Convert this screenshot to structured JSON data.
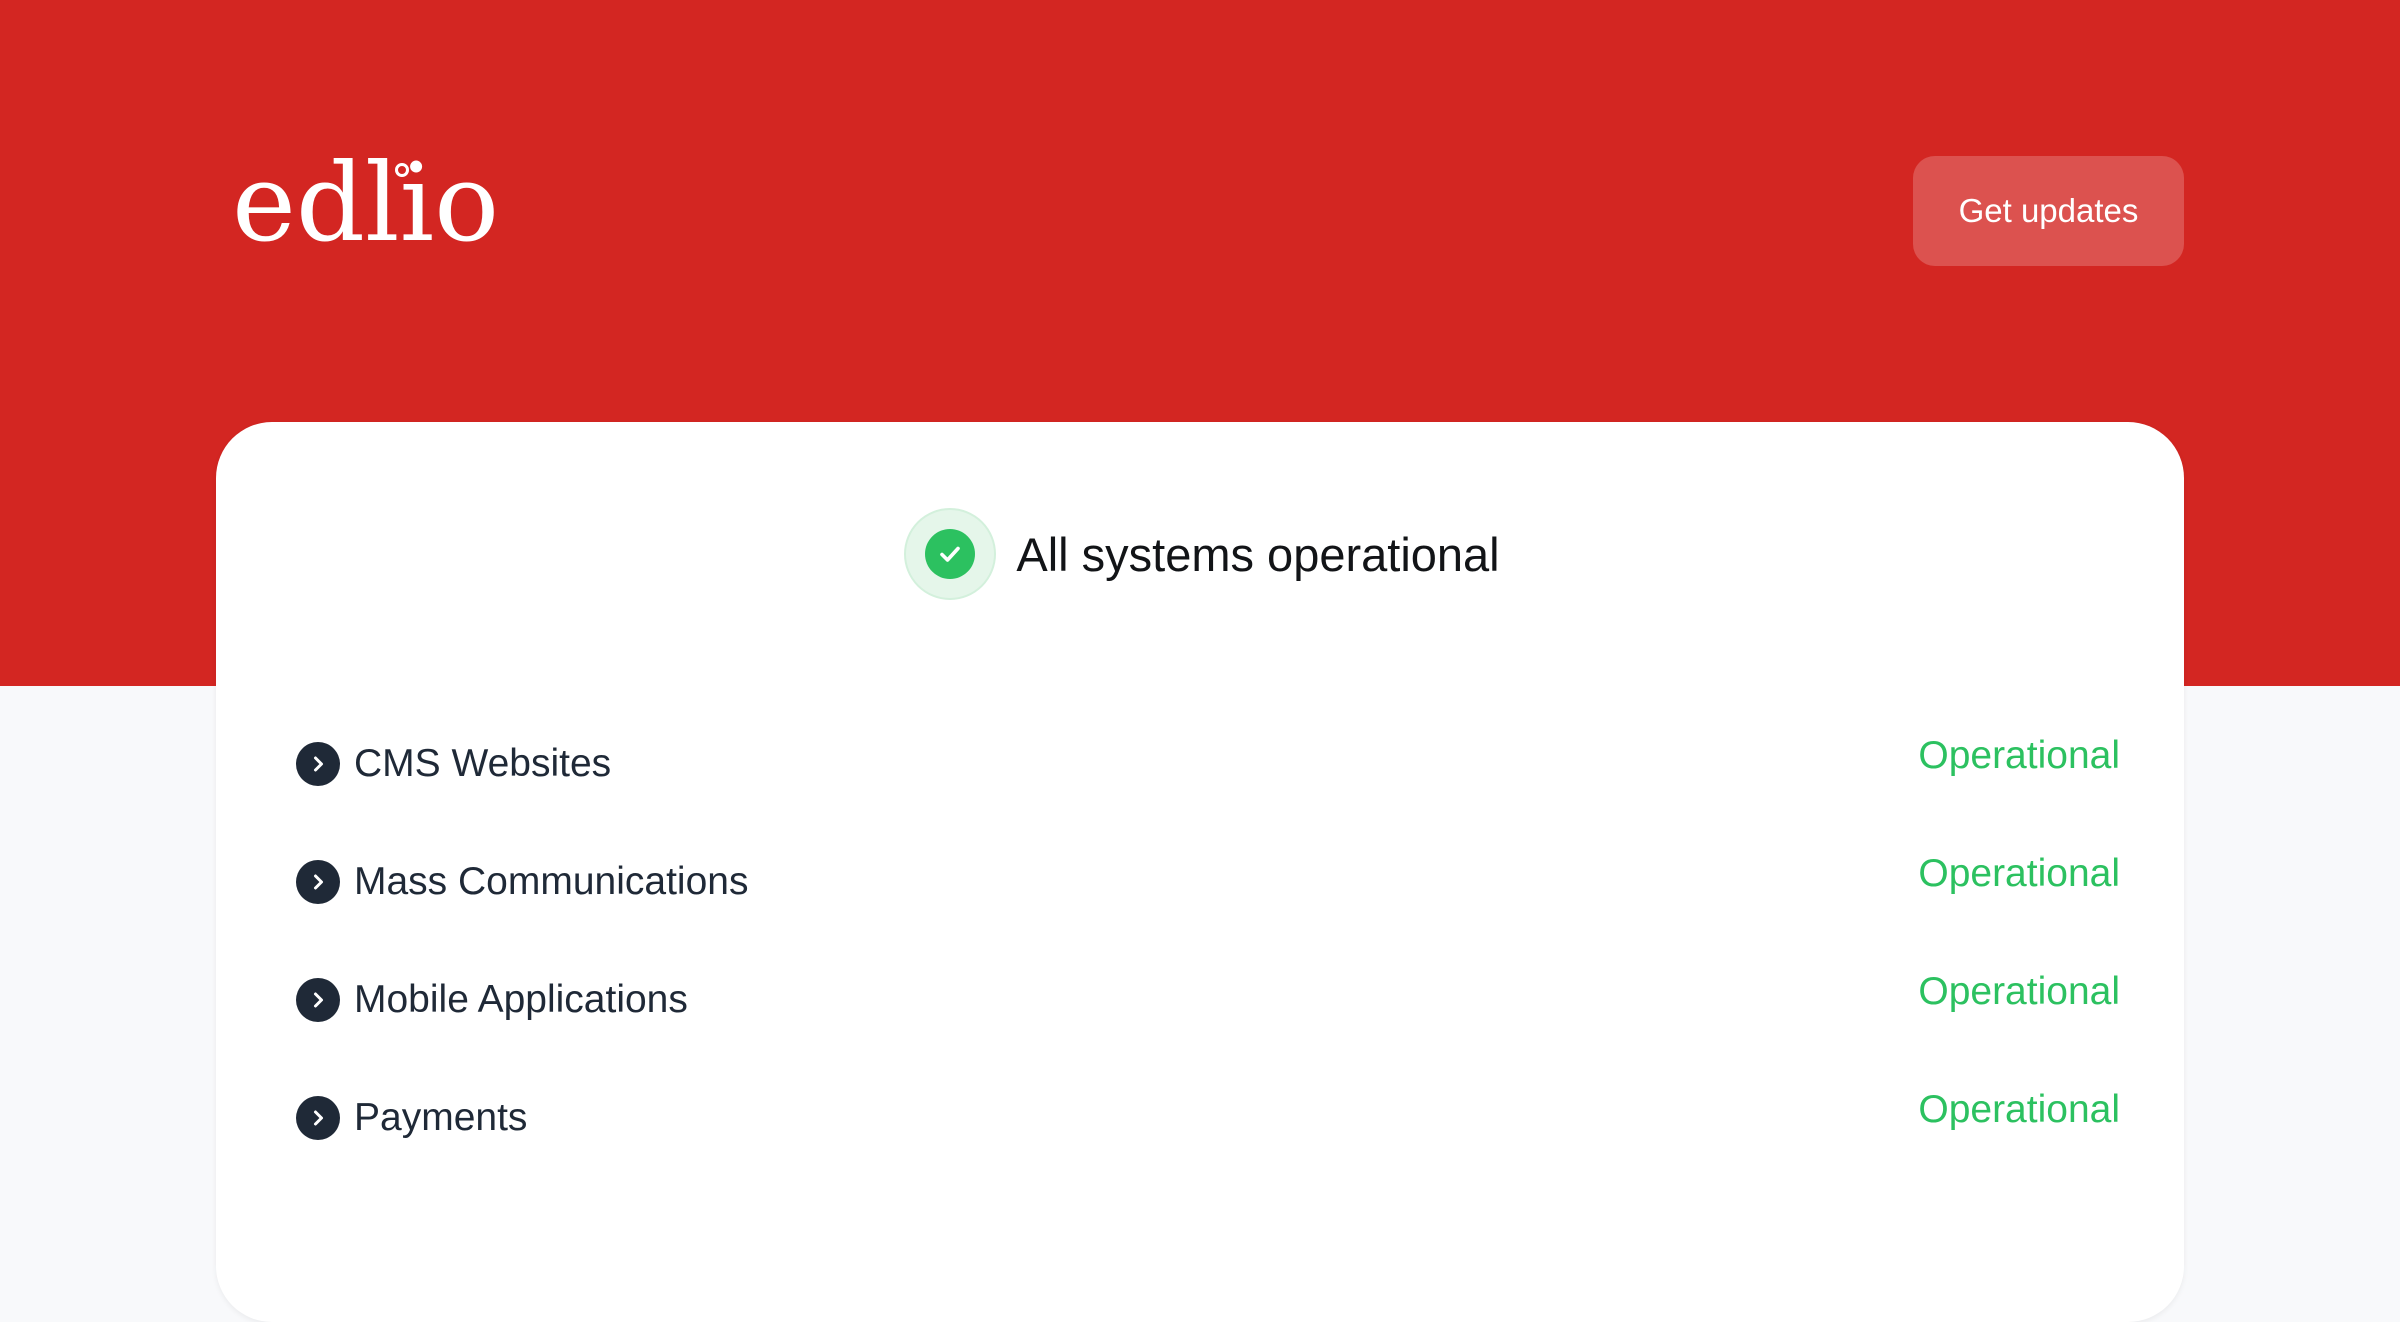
{
  "header": {
    "logo_text": "edlio",
    "get_updates_label": "Get updates"
  },
  "overall_status": {
    "text": "All systems operational",
    "icon": "check-icon",
    "color": "#2cc160"
  },
  "components": [
    {
      "name": "CMS Websites",
      "status": "Operational"
    },
    {
      "name": "Mass Communications",
      "status": "Operational"
    },
    {
      "name": "Mobile Applications",
      "status": "Operational"
    },
    {
      "name": "Payments",
      "status": "Operational"
    }
  ],
  "colors": {
    "brand": "#d32622",
    "button": "#dc524f",
    "operational": "#2cc160",
    "text_dark": "#1f2937"
  }
}
